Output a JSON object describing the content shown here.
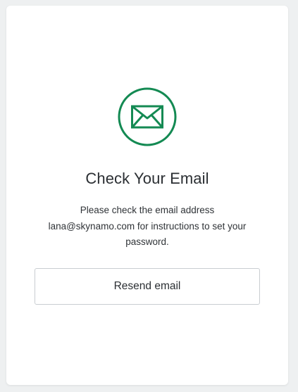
{
  "card": {
    "title": "Check Your Email",
    "message_line1": "Please check the email address",
    "message_line2": "lana@skynamo.com for instructions to set your",
    "message_line3": "password.",
    "resend_button_label": "Resend email"
  },
  "colors": {
    "accent": "#148a53",
    "background": "#eef0f1",
    "card": "#ffffff"
  },
  "icons": {
    "status_icon": "envelope-icon"
  }
}
